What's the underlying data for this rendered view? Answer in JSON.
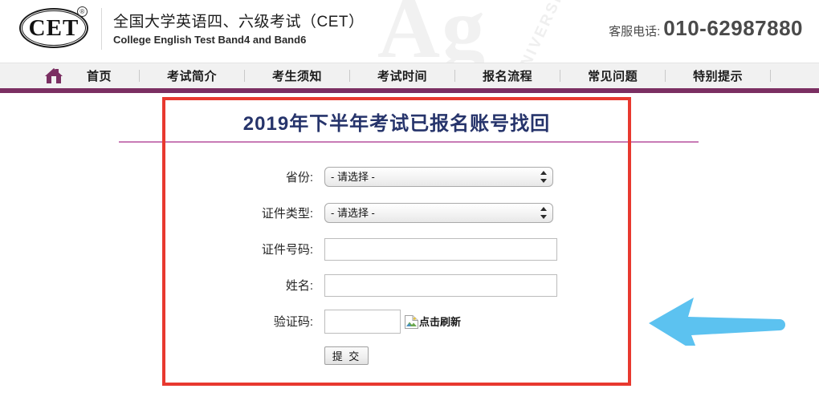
{
  "header": {
    "logo_text": "CET",
    "logo_registered_mark": "®",
    "title_cn": "全国大学英语四、六级考试（CET）",
    "title_en": "College English Test Band4 and Band6",
    "watermark_text": "Ag",
    "watermark_rotated_text": "NIVERSITY",
    "service_phone_label": "客服电话:",
    "service_phone_number": "010-62987880"
  },
  "nav": {
    "home_icon": "home-icon",
    "items": [
      {
        "label": "首页"
      },
      {
        "label": "考试简介"
      },
      {
        "label": "考生须知"
      },
      {
        "label": "考试时间"
      },
      {
        "label": "报名流程"
      },
      {
        "label": "常见问题"
      },
      {
        "label": "特别提示"
      }
    ]
  },
  "form": {
    "title": "2019年下半年考试已报名账号找回",
    "fields": [
      {
        "label": "省份:",
        "type": "select",
        "value": "- 请选择 -"
      },
      {
        "label": "证件类型:",
        "type": "select",
        "value": "- 请选择 -"
      },
      {
        "label": "证件号码:",
        "type": "text",
        "value": "",
        "placeholder": ""
      },
      {
        "label": "姓名:",
        "type": "text",
        "value": "",
        "placeholder": ""
      },
      {
        "label": "验证码:",
        "type": "captcha",
        "value": "",
        "placeholder": ""
      }
    ],
    "captcha_refresh_label": "点击刷新",
    "captcha_image_alt": "点击刷新",
    "submit_label": "提 交"
  },
  "annotation": {
    "arrow_direction": "left",
    "arrow_color": "#5CC2F0"
  },
  "colors": {
    "nav_accent": "#7B2F62",
    "highlight_border": "#E8392F",
    "divider_pink": "#C87BB6",
    "title_navy": "#26346B",
    "arrow_blue": "#5CC2F0"
  }
}
